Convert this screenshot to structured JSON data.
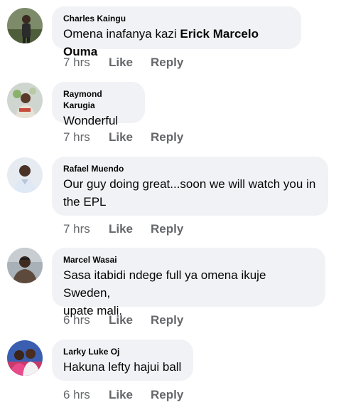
{
  "comments": [
    {
      "author": "Charles Kaingu",
      "text_before": "Omena inafanya kazi ",
      "mention": "Erick Marcelo Ouma",
      "time": "7 hrs",
      "like_label": "Like",
      "reply_label": "Reply",
      "avatar": "profile-photo"
    },
    {
      "author": "Raymond Karugia",
      "text": "Wonderful",
      "time": "7 hrs",
      "like_label": "Like",
      "reply_label": "Reply",
      "avatar": "profile-photo"
    },
    {
      "author": "Rafael Muendo",
      "text_line1": "Our guy doing great...soon we will watch you in",
      "text_line2": "the EPL",
      "time": "7 hrs",
      "like_label": "Like",
      "reply_label": "Reply",
      "avatar": "profile-photo"
    },
    {
      "author": "Marcel Wasai",
      "text_line1": "Sasa itabidi ndege full ya omena ikuje Sweden,",
      "text_line2": "upate mali.",
      "time": "6 hrs",
      "like_label": "Like",
      "reply_label": "Reply",
      "avatar": "profile-photo"
    },
    {
      "author": "Larky Luke Oj",
      "text": "Hakuna lefty hajui ball",
      "time": "6 hrs",
      "like_label": "Like",
      "reply_label": "Reply",
      "avatar": "profile-photo"
    }
  ],
  "colors": {
    "bubble_bg": "#f0f2f5",
    "text": "#050505",
    "secondary": "#65676b"
  }
}
